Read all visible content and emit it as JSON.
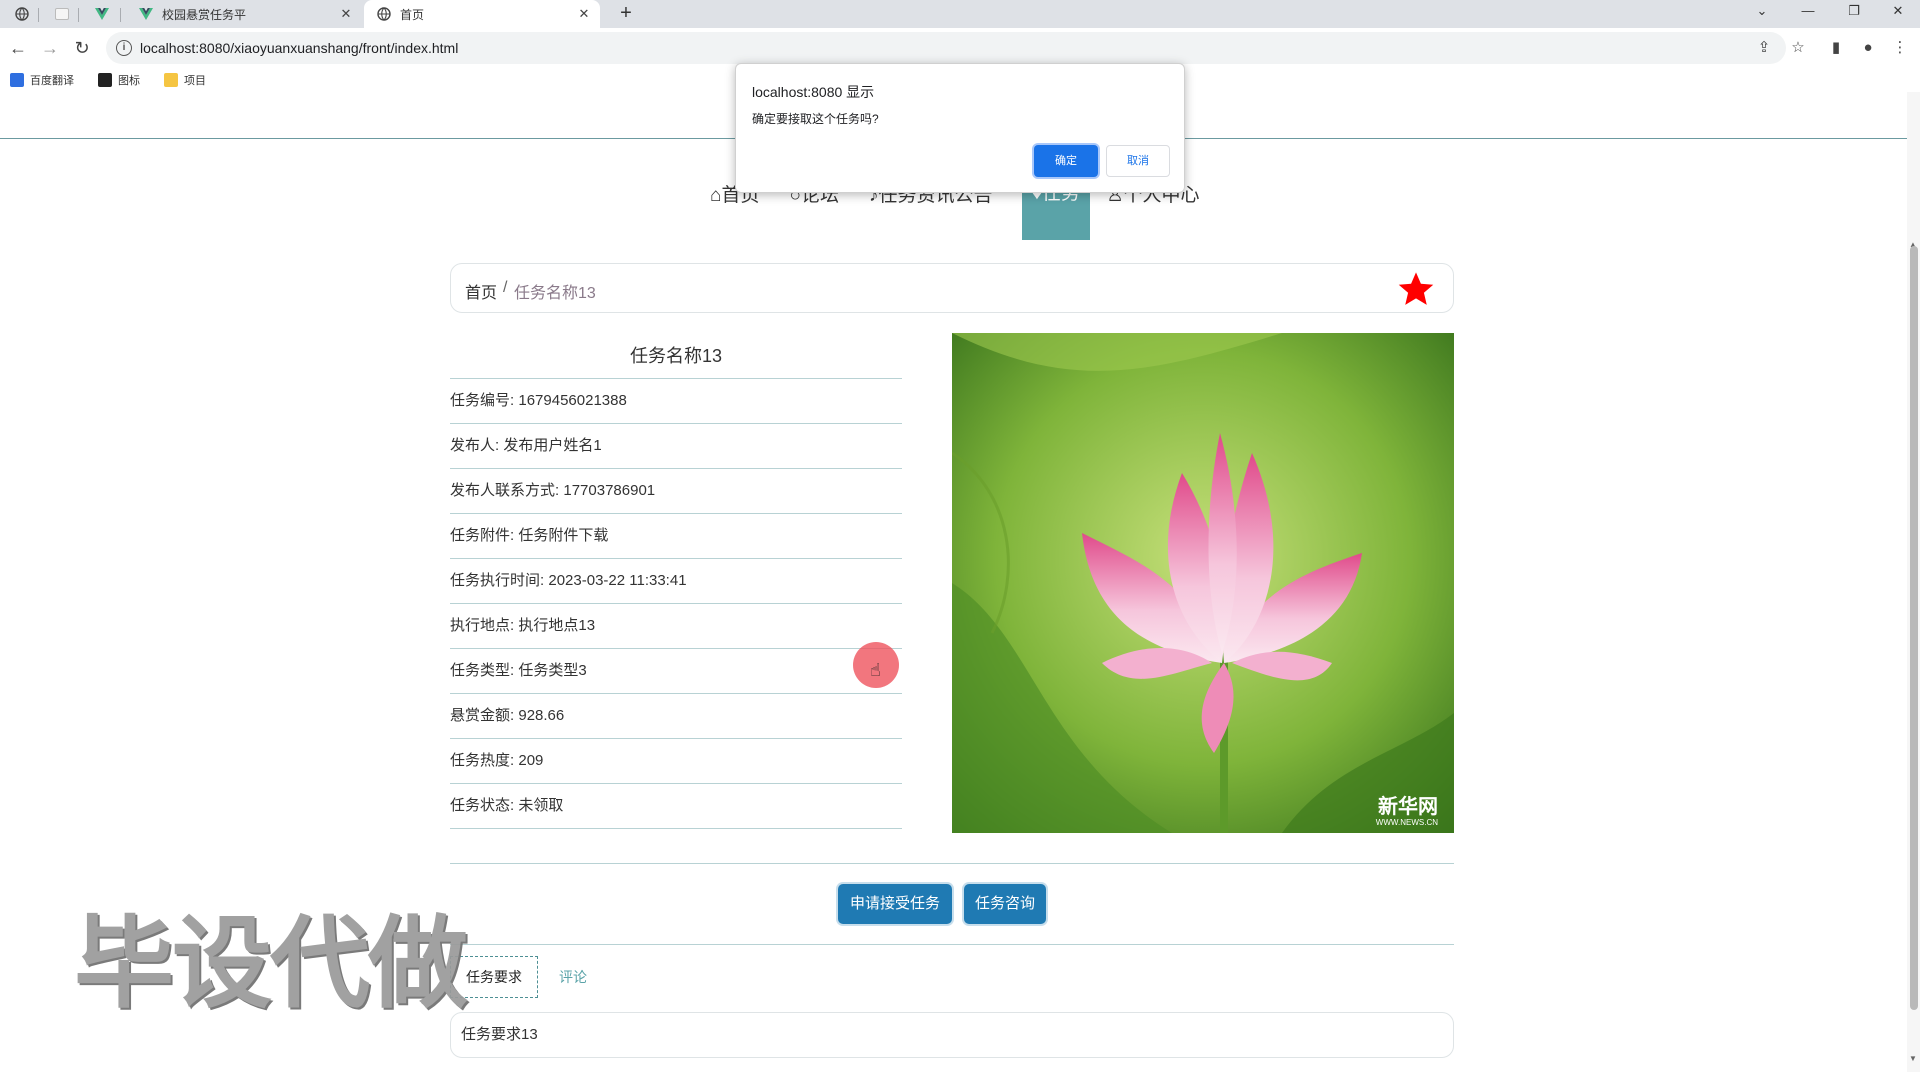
{
  "browser": {
    "tabs": [
      {
        "title": "",
        "icon": "globe-icon",
        "pinned": true
      },
      {
        "title": "",
        "icon": "blank-page-icon",
        "pinned": true
      },
      {
        "title": "",
        "icon": "vue-icon",
        "pinned": true
      },
      {
        "title": "校园悬赏任务平",
        "icon": "vue-icon",
        "active": false
      },
      {
        "title": "首页",
        "icon": "globe-icon",
        "active": true
      }
    ],
    "url": "localhost:8080/xiaoyuanxuanshang/front/index.html",
    "bookmarks": [
      {
        "label": "百度翻译",
        "icon": "translate-icon",
        "color": "#2f6fe0"
      },
      {
        "label": "图标",
        "icon": "image-icon",
        "color": "#222222"
      },
      {
        "label": "项目",
        "icon": "folder-icon",
        "color": "#f5c542"
      }
    ]
  },
  "nav": {
    "items": [
      "⌂首页",
      "○论坛",
      "♪任务资讯公告",
      "",
      "♙个人中心"
    ],
    "active_label": "♦任务"
  },
  "breadcrumb": {
    "home": "首页",
    "separator": "/",
    "current": "任务名称13",
    "star_color": "#ff0000"
  },
  "task": {
    "title": "任务名称13",
    "fields": [
      {
        "label": "任务编号",
        "value": "1679456021388"
      },
      {
        "label": "发布人",
        "value": "发布用户姓名1"
      },
      {
        "label": "发布人联系方式",
        "value": "17703786901"
      },
      {
        "label": "任务附件",
        "value": "任务附件下载"
      },
      {
        "label": "任务执行时间",
        "value": "2023-03-22 11:33:41"
      },
      {
        "label": "执行地点",
        "value": "执行地点13"
      },
      {
        "label": "任务类型",
        "value": "任务类型3"
      },
      {
        "label": "悬赏金额",
        "value": "928.66"
      },
      {
        "label": "任务热度",
        "value": "209"
      },
      {
        "label": "任务状态",
        "value": "未领取"
      }
    ]
  },
  "photo": {
    "watermark": "新华网",
    "watermark_sub": "WWW.NEWS.CN"
  },
  "actions": {
    "apply": "申请接受任务",
    "consult": "任务咨询"
  },
  "detail_tabs": {
    "requirements": "任务要求",
    "comments": "评论"
  },
  "requirements_text": "任务要求13",
  "overlay": "毕设代做",
  "dialog": {
    "title": "localhost:8080 显示",
    "message": "确定要接取这个任务吗?",
    "ok": "确定",
    "cancel": "取消"
  },
  "colors": {
    "accent": "#5aa3a8",
    "button": "#1f7ab3",
    "dialog_ok": "#1a73e8"
  }
}
